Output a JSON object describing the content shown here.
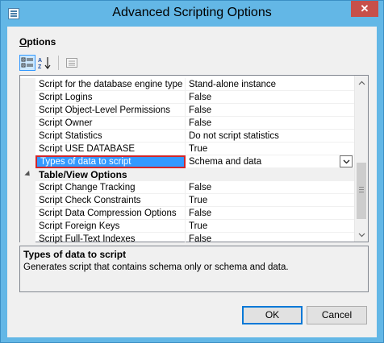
{
  "window": {
    "title": "Advanced Scripting Options",
    "close_glyph": "✕"
  },
  "options_header": {
    "access_key": "O",
    "rest": "ptions"
  },
  "toolbar": {
    "categorized_icon": "categorized-view-icon",
    "alphabetical_icon": "alphabetical-sort-icon",
    "property_pages_icon": "property-pages-icon"
  },
  "grid": {
    "rows": [
      {
        "name": "Script for the database engine type",
        "value": "Stand-alone instance"
      },
      {
        "name": "Script Logins",
        "value": "False"
      },
      {
        "name": "Script Object-Level Permissions",
        "value": "False"
      },
      {
        "name": "Script Owner",
        "value": "False"
      },
      {
        "name": "Script Statistics",
        "value": "Do not script statistics"
      },
      {
        "name": "Script USE DATABASE",
        "value": "True"
      },
      {
        "name": "Types of data to script",
        "value": "Schema and data"
      }
    ],
    "category": "Table/View Options",
    "category_rows": [
      {
        "name": "Script Change Tracking",
        "value": "False"
      },
      {
        "name": "Script Check Constraints",
        "value": "True"
      },
      {
        "name": "Script Data Compression Options",
        "value": "False"
      },
      {
        "name": "Script Foreign Keys",
        "value": "True"
      },
      {
        "name": "Script Full-Text Indexes",
        "value": "False"
      }
    ]
  },
  "description": {
    "title": "Types of data to script",
    "text": "Generates script that contains schema only or schema and data."
  },
  "buttons": {
    "ok": "OK",
    "cancel": "Cancel"
  },
  "colors": {
    "titlebar": "#63b7e6",
    "selection": "#3399ff",
    "highlight_border": "#d3262a"
  }
}
